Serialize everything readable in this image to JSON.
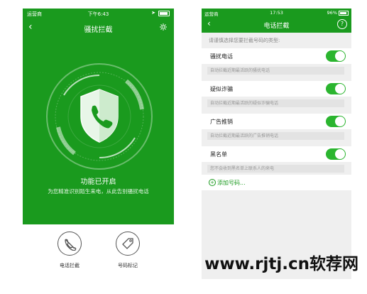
{
  "left_phone": {
    "status_bar": {
      "carrier": "运营商",
      "time": "下午6:43"
    },
    "nav": {
      "title": "骚扰拦截"
    },
    "status_title": "功能已开启",
    "status_subtitle": "为您精准识别陌生来电，从此告别骚扰电话",
    "bottom_buttons": [
      {
        "label": "电话拦截",
        "icon": "phone-blocked-icon"
      },
      {
        "label": "号码标记",
        "icon": "tag-icon"
      }
    ],
    "colors": {
      "primary": "#1a9a1e"
    }
  },
  "right_phone": {
    "status_bar": {
      "carrier": "运营商",
      "time": "17:53",
      "battery": "96%"
    },
    "nav": {
      "title": "电话拦截",
      "help": "?"
    },
    "hint": "请谨慎选择您要拦截号码的类型:",
    "items": [
      {
        "label": "骚扰电话",
        "desc": "自动拦截近期最活跃的骚扰电话",
        "enabled": true
      },
      {
        "label": "疑似诈骗",
        "desc": "自动拦截近期最活跃的疑似诈骗电话",
        "enabled": true
      },
      {
        "label": "广告推销",
        "desc": "自动拦截近期最活跃的广告推销电话",
        "enabled": true
      },
      {
        "label": "黑名单",
        "desc": "您不会收到黑名单上联系人的来电",
        "enabled": true
      }
    ],
    "add_number": "添加号码..."
  },
  "watermark": "www.rjtj.cn软荐网"
}
